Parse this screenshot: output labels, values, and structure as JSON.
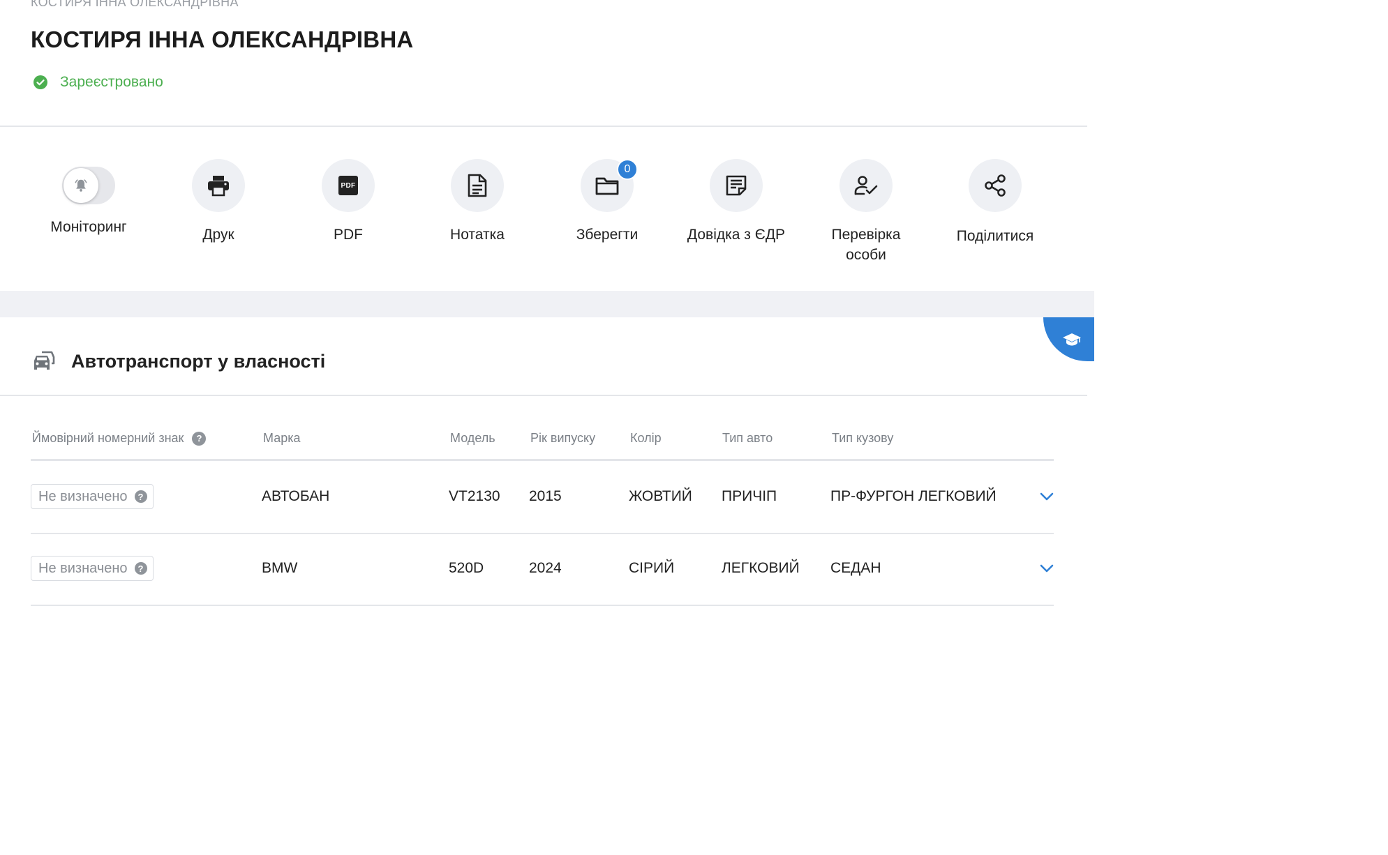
{
  "header": {
    "breadcrumb": "КОСТИРЯ ІННА ОЛЕКСАНДРІВНА",
    "title": "КОСТИРЯ ІННА ОЛЕКСАНДРІВНА",
    "status": "Зареєстровано"
  },
  "actions": {
    "monitoring": "Моніторинг",
    "print": "Друк",
    "pdf": "PDF",
    "pdf_icon_text": "PDF",
    "note": "Нотатка",
    "save": "Зберегти",
    "save_count": "0",
    "edr": "Довідка з ЄДР",
    "verify_line1": "Перевірка",
    "verify_line2": "особи",
    "share": "Поділитися"
  },
  "vehicles": {
    "title": "Автотранспорт у власності",
    "columns": {
      "plate": "Ймовірний номерний знак",
      "brand": "Марка",
      "model": "Модель",
      "year": "Рік випуску",
      "color": "Колір",
      "type": "Тип авто",
      "body": "Тип кузову"
    },
    "rows": [
      {
        "plate": "Не визначено",
        "brand": "АВТОБАН",
        "model": "VT2130",
        "year": "2015",
        "color": "ЖОВТИЙ",
        "type": "ПРИЧІП",
        "body": "ПР-ФУРГОН ЛЕГКОВИЙ"
      },
      {
        "plate": "Не визначено",
        "brand": "BMW",
        "model": "520D",
        "year": "2024",
        "color": "СІРИЙ",
        "type": "ЛЕГКОВИЙ",
        "body": "СЕДАН"
      }
    ]
  },
  "colors": {
    "accent": "#2f80d6",
    "success": "#4caf50",
    "band": "#f0f1f5"
  },
  "icons": [
    "check-circle-icon",
    "bell-icon",
    "printer-icon",
    "pdf-icon",
    "note-icon",
    "folder-icon",
    "document-icon",
    "user-check-icon",
    "share-icon",
    "graduation-cap-icon",
    "cars-icon",
    "help-icon",
    "chevron-down-icon"
  ]
}
